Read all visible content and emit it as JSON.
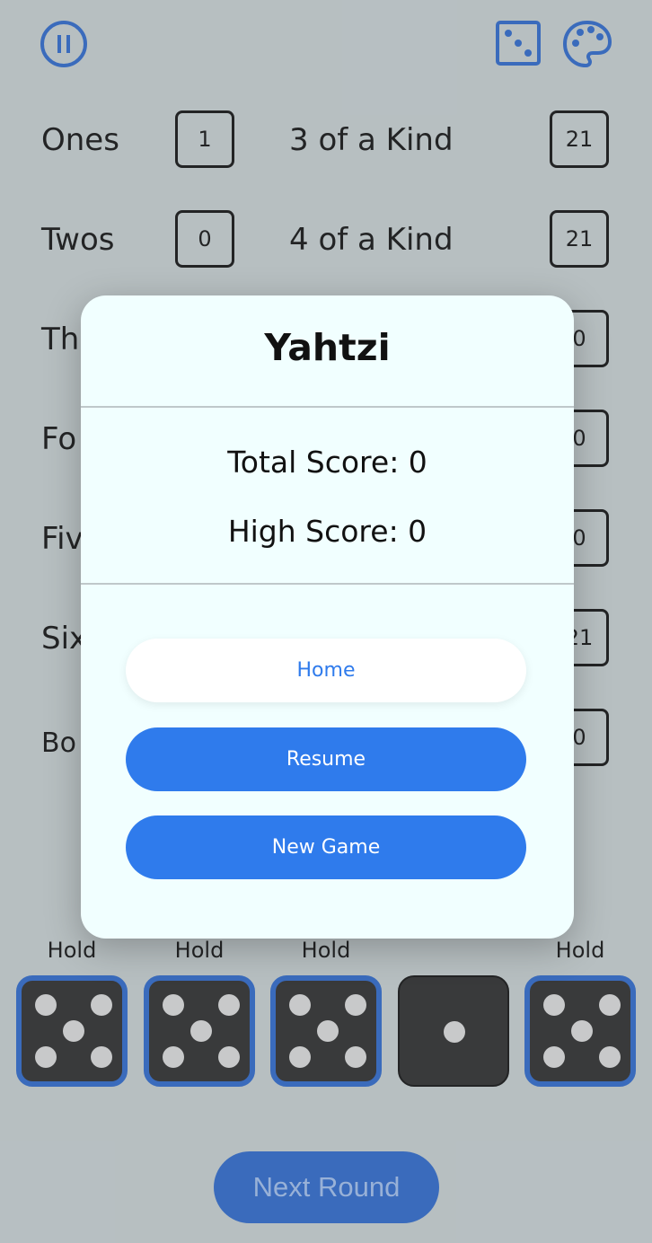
{
  "colors": {
    "background": "#c5cdcf",
    "accent": "#2f7bec",
    "die_held_border": "#2d67c8",
    "die_face": "#2b2b2b",
    "modal_bg": "#f1ffff"
  },
  "toolbar": {
    "pause_icon": "pause-icon",
    "dice_icon": "dice-icon",
    "palette_icon": "palette-icon"
  },
  "scoreboard": {
    "left": [
      {
        "label": "Ones",
        "value": "1"
      },
      {
        "label": "Twos",
        "value": "0"
      },
      {
        "label": "Th"
      },
      {
        "label": "Fo"
      },
      {
        "label": "Fiv"
      },
      {
        "label": "Six"
      },
      {
        "label": "Bo"
      }
    ],
    "right": [
      {
        "label": "3 of a Kind",
        "value": "21"
      },
      {
        "label": "4 of a Kind",
        "value": "21"
      },
      {
        "value": "0"
      },
      {
        "value": "0"
      },
      {
        "value": "0"
      },
      {
        "value": "21"
      },
      {
        "value": "0"
      }
    ]
  },
  "dice": [
    {
      "hold_label": "Hold",
      "held": true,
      "value": 5
    },
    {
      "hold_label": "Hold",
      "held": true,
      "value": 5
    },
    {
      "hold_label": "Hold",
      "held": true,
      "value": 5
    },
    {
      "hold_label": "",
      "held": false,
      "value": 1
    },
    {
      "hold_label": "Hold",
      "held": true,
      "value": 5
    }
  ],
  "next_round_label": "Next Round",
  "modal": {
    "title": "Yahtzi",
    "total_score": "Total Score: 0",
    "high_score": "High Score: 0",
    "home_label": "Home",
    "resume_label": "Resume",
    "new_game_label": "New Game"
  }
}
